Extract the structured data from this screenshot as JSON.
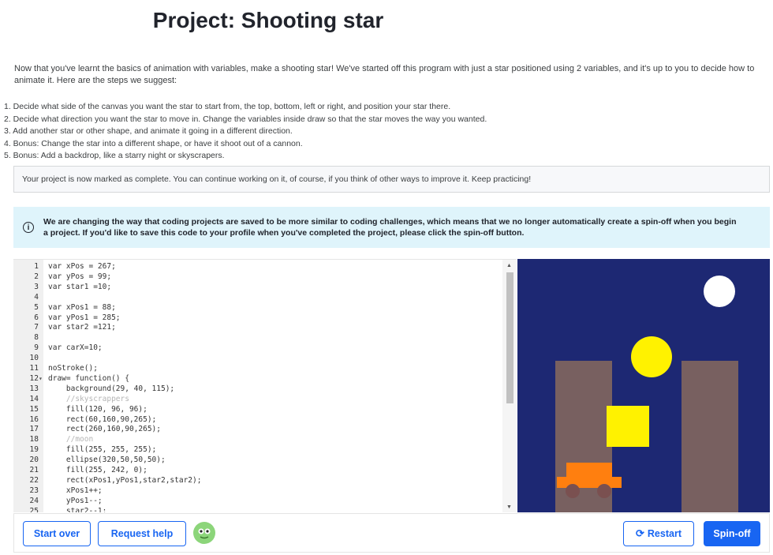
{
  "page": {
    "title": "Project: Shooting star",
    "intro": "Now that you've learnt the basics of animation with variables, make a shooting star! We've started off this program with just a star positioned using 2 variables, and it's up to you to decide how to animate it. Here are the steps we suggest:",
    "steps": [
      "1. Decide what side of the canvas you want the star to start from, the top, bottom, left or right, and position your star there.",
      "2. Decide what direction you want the star to move in. Change the variables inside draw so that the star moves the way you wanted.",
      "3. Add another star or other shape, and animate it going in a different direction.",
      "4. Bonus: Change the star into a different shape, or have it shoot out of a cannon.",
      "5. Bonus: Add a backdrop, like a starry night or skyscrapers."
    ],
    "complete_message": "Your project is now marked as complete. You can continue working on it, of course, if you think of other ways to improve it. Keep practicing!",
    "info_message": "We are changing the way that coding projects are saved to be more similar to coding challenges, which means that we no longer automatically create a spin-off when you begin a project. If you'd like to save this code to your profile when you've completed the project, please click the spin-off button.",
    "info_icon": "info-circle-icon"
  },
  "editor": {
    "lines": [
      {
        "n": "1",
        "text": "var xPos = 267;"
      },
      {
        "n": "2",
        "text": "var yPos = 99;"
      },
      {
        "n": "3",
        "text": "var star1 =10;"
      },
      {
        "n": "4",
        "text": ""
      },
      {
        "n": "5",
        "text": "var xPos1 = 88;"
      },
      {
        "n": "6",
        "text": "var yPos1 = 285;"
      },
      {
        "n": "7",
        "text": "var star2 =121;"
      },
      {
        "n": "8",
        "text": ""
      },
      {
        "n": "9",
        "text": "var carX=10;"
      },
      {
        "n": "10",
        "text": ""
      },
      {
        "n": "11",
        "text": "noStroke();"
      },
      {
        "n": "12",
        "text": "draw= function() {",
        "fold": true
      },
      {
        "n": "13",
        "text": "    background(29, 40, 115);"
      },
      {
        "n": "14",
        "text": "    //skyscrappers",
        "comment": true
      },
      {
        "n": "15",
        "text": "    fill(120, 96, 96);"
      },
      {
        "n": "16",
        "text": "    rect(60,160,90,265);"
      },
      {
        "n": "17",
        "text": "    rect(260,160,90,265);"
      },
      {
        "n": "18",
        "text": "    //moon",
        "comment": true
      },
      {
        "n": "19",
        "text": "    fill(255, 255, 255);"
      },
      {
        "n": "20",
        "text": "    ellipse(320,50,50,50);"
      },
      {
        "n": "21",
        "text": "    fill(255, 242, 0);"
      },
      {
        "n": "22",
        "text": "    rect(xPos1,yPos1,star2,star2);"
      },
      {
        "n": "23",
        "text": "    xPos1++;"
      },
      {
        "n": "24",
        "text": "    yPos1--;"
      },
      {
        "n": "25",
        "text": "    star2--1;"
      }
    ]
  },
  "canvas_colors": {
    "background": "#1d2873",
    "building": "#786060",
    "moon": "#ffffff",
    "star": "#fff200",
    "car": "#ff7f0f",
    "wheel": "#7a5050"
  },
  "buttons": {
    "start_over": "Start over",
    "request_help": "Request help",
    "restart": "Restart",
    "spinoff": "Spin-off",
    "restart_icon": "refresh-icon"
  }
}
